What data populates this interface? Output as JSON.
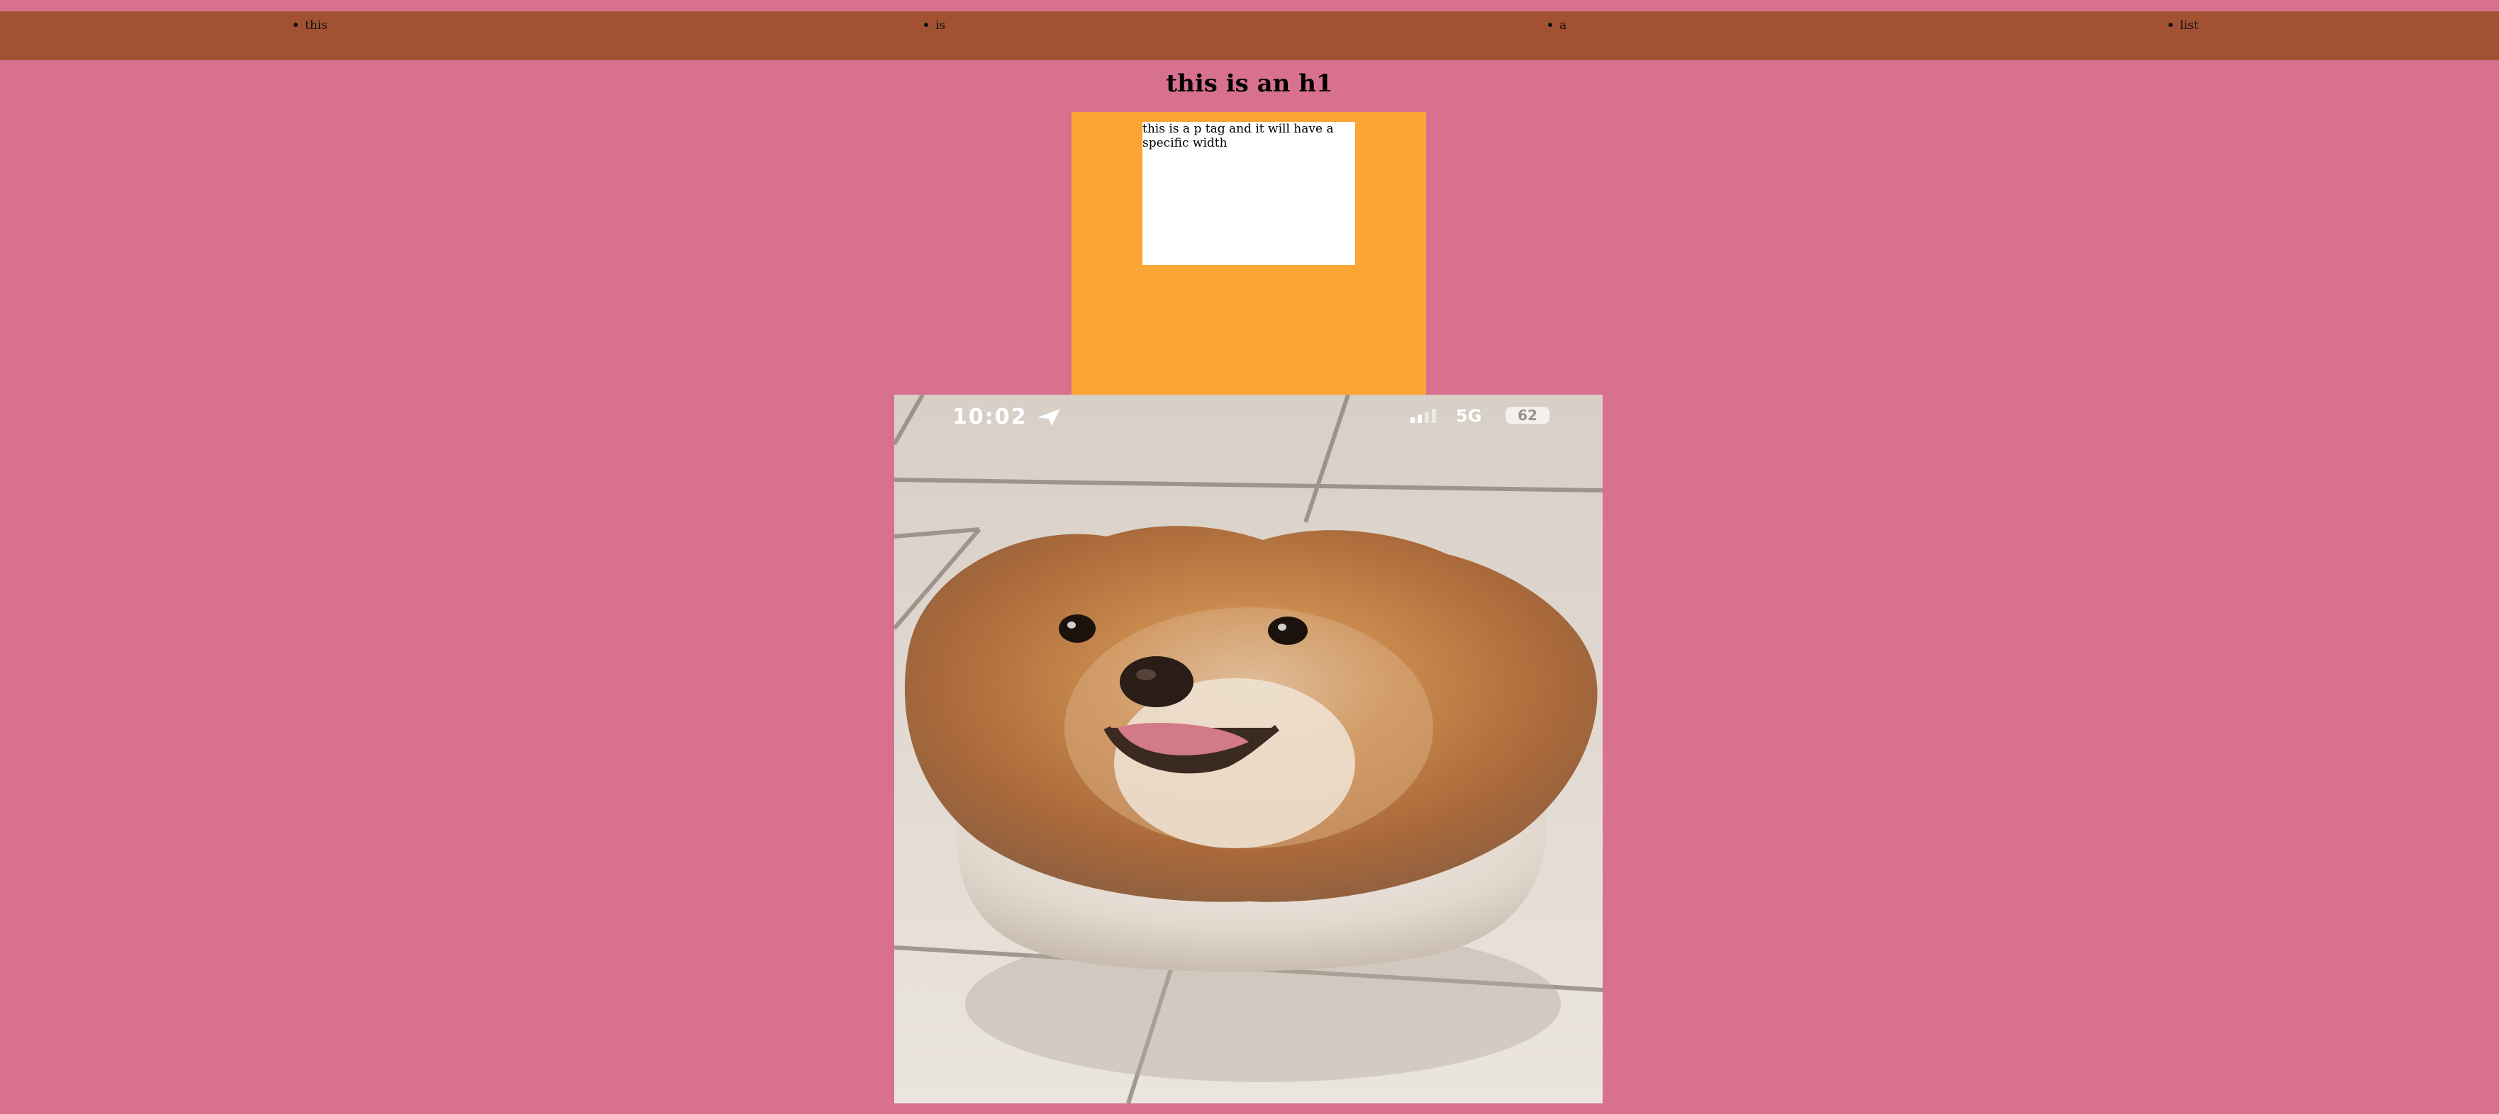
{
  "nav": {
    "items": [
      "this",
      "is",
      "a",
      "list"
    ]
  },
  "heading": "this is an h1",
  "paragraph": "this is a p tag and it will have a specific width",
  "photo": {
    "status_time": "10:02",
    "status_network": "5G",
    "status_battery": "62",
    "colors": {
      "tile": "#e6dfd8",
      "grout": "#8a7f76",
      "fur_orange": "#b8743c",
      "fur_cream": "#ece3d8"
    }
  },
  "colors": {
    "background": "#d87190",
    "nav": "#a25233",
    "box": "#faa535",
    "paragraph_bg": "#ffffff"
  }
}
